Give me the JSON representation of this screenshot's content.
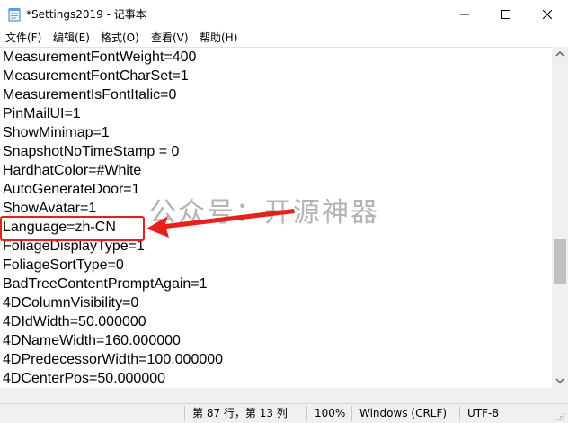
{
  "window": {
    "title": "*Settings2019 - 记事本"
  },
  "menu": {
    "items": [
      {
        "label": "文件(F)"
      },
      {
        "label": "编辑(E)"
      },
      {
        "label": "格式(O)"
      },
      {
        "label": "查看(V)"
      },
      {
        "label": "帮助(H)"
      }
    ]
  },
  "editor": {
    "lines": [
      "MeasurementFontWeight=400",
      "MeasurementFontCharSet=1",
      "MeasurementIsFontItalic=0",
      "PinMailUI=1",
      "ShowMinimap=1",
      "SnapshotNoTimeStamp = 0",
      "HardhatColor=#White",
      "AutoGenerateDoor=1",
      "ShowAvatar=1",
      "Language=zh-CN",
      "FoliageDisplayType=1",
      "FoliageSortType=0",
      "BadTreeContentPromptAgain=1",
      "4DColumnVisibility=0",
      "4DIdWidth=50.000000",
      "4DNameWidth=160.000000",
      "4DPredecessorWidth=100.000000",
      "4DCenterPos=50.000000"
    ]
  },
  "status": {
    "position": "第 87 行，第 13 列",
    "zoom": "100%",
    "line_ending": "Windows (CRLF)",
    "encoding": "UTF-8"
  },
  "annotation": {
    "watermark": "公众号：开源神器",
    "color": "#e8201c"
  }
}
